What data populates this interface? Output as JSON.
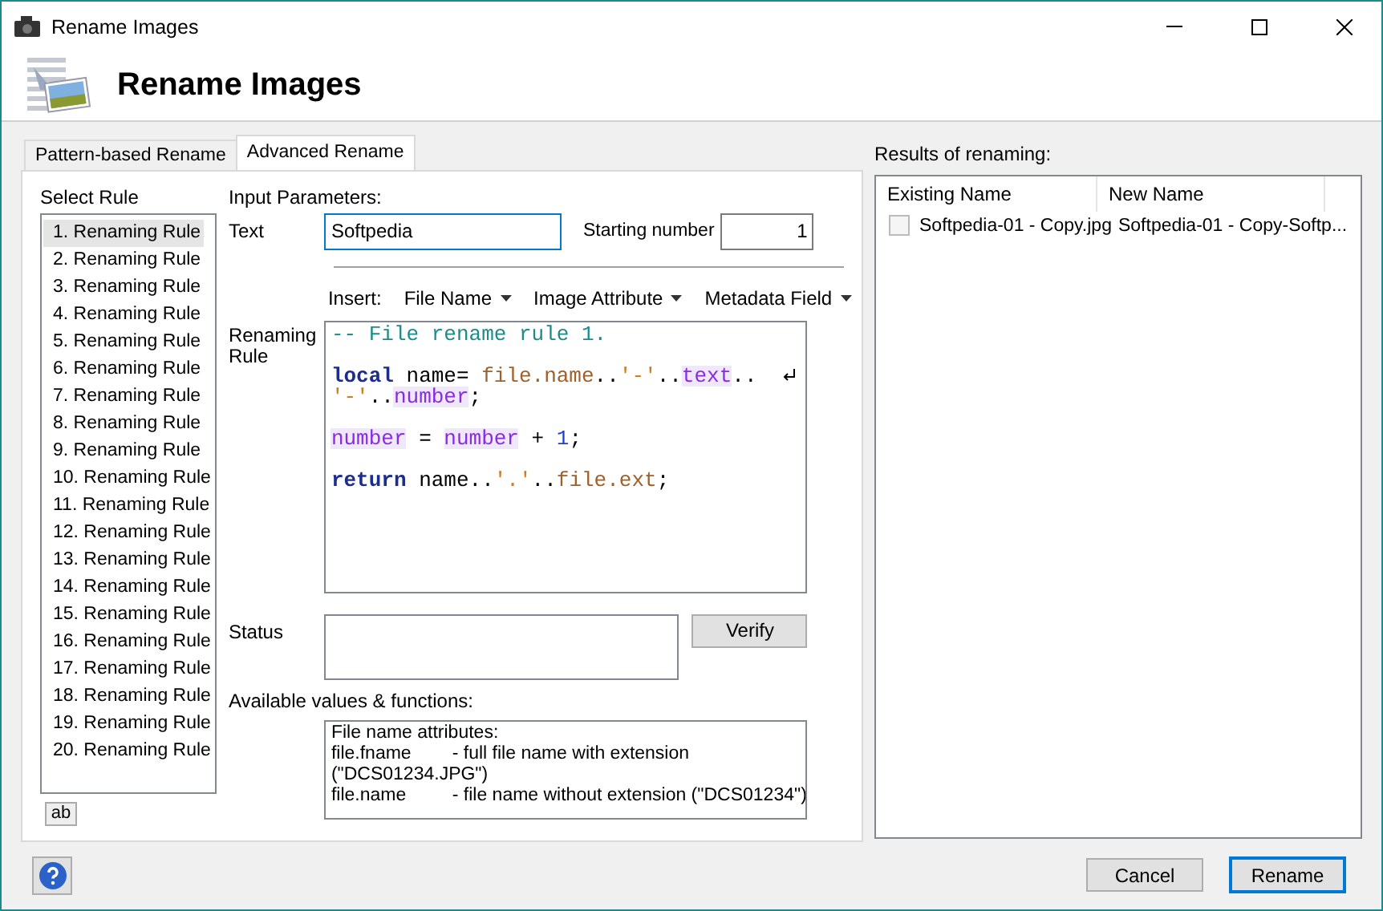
{
  "window": {
    "title": "Rename Images",
    "header": "Rename Images"
  },
  "tabs": [
    {
      "label": "Pattern-based Rename",
      "selected": false
    },
    {
      "label": "Advanced Rename",
      "selected": true
    }
  ],
  "rules": {
    "label": "Select Rule",
    "items": [
      {
        "label": "1. Renaming Rule",
        "selected": true
      },
      {
        "label": "2. Renaming Rule",
        "selected": false
      },
      {
        "label": "3. Renaming Rule",
        "selected": false
      },
      {
        "label": "4. Renaming Rule",
        "selected": false
      },
      {
        "label": "5. Renaming Rule",
        "selected": false
      },
      {
        "label": "6. Renaming Rule",
        "selected": false
      },
      {
        "label": "7. Renaming Rule",
        "selected": false
      },
      {
        "label": "8. Renaming Rule",
        "selected": false
      },
      {
        "label": "9. Renaming Rule",
        "selected": false
      },
      {
        "label": "10. Renaming Rule",
        "selected": false
      },
      {
        "label": "11. Renaming Rule",
        "selected": false
      },
      {
        "label": "12. Renaming Rule",
        "selected": false
      },
      {
        "label": "13. Renaming Rule",
        "selected": false
      },
      {
        "label": "14. Renaming Rule",
        "selected": false
      },
      {
        "label": "15. Renaming Rule",
        "selected": false
      },
      {
        "label": "16. Renaming Rule",
        "selected": false
      },
      {
        "label": "17. Renaming Rule",
        "selected": false
      },
      {
        "label": "18. Renaming Rule",
        "selected": false
      },
      {
        "label": "19. Renaming Rule",
        "selected": false
      },
      {
        "label": "20. Renaming Rule",
        "selected": false
      }
    ],
    "edit_button": "ab"
  },
  "params": {
    "heading": "Input Parameters:",
    "text_label": "Text",
    "text_value": "Softpedia",
    "start_label": "Starting number",
    "start_value": "1",
    "insert_label": "Insert:",
    "insert_menus": [
      "File Name",
      "Image Attribute",
      "Metadata Field"
    ],
    "rule_label": [
      "Renaming",
      "Rule"
    ],
    "code": [
      {
        "gap_before": false,
        "wrapped": false,
        "tokens": [
          {
            "kind": "comment",
            "text": "-- File rename rule 1."
          }
        ]
      },
      {
        "gap_before": true,
        "wrapped": true,
        "tokens": [
          {
            "kind": "keyword",
            "text": "local"
          },
          {
            "kind": "plain",
            "text": " name= "
          },
          {
            "kind": "field",
            "text": "file.name"
          },
          {
            "kind": "plain",
            "text": ".."
          },
          {
            "kind": "string",
            "text": "'-'"
          },
          {
            "kind": "plain",
            "text": ".."
          },
          {
            "kind": "variable",
            "text": "text"
          },
          {
            "kind": "plain",
            "text": ".."
          }
        ]
      },
      {
        "gap_before": false,
        "wrapped": false,
        "tokens": [
          {
            "kind": "string",
            "text": "'-'"
          },
          {
            "kind": "plain",
            "text": ".."
          },
          {
            "kind": "variable",
            "text": "number"
          },
          {
            "kind": "plain",
            "text": ";"
          }
        ]
      },
      {
        "gap_before": true,
        "wrapped": false,
        "tokens": [
          {
            "kind": "variable",
            "text": "number"
          },
          {
            "kind": "plain",
            "text": " = "
          },
          {
            "kind": "variable",
            "text": "number"
          },
          {
            "kind": "plain",
            "text": " + "
          },
          {
            "kind": "number",
            "text": "1"
          },
          {
            "kind": "plain",
            "text": ";"
          }
        ]
      },
      {
        "gap_before": true,
        "wrapped": false,
        "tokens": [
          {
            "kind": "keyword",
            "text": "return"
          },
          {
            "kind": "plain",
            "text": " name.."
          },
          {
            "kind": "string",
            "text": "'.'"
          },
          {
            "kind": "plain",
            "text": ".."
          },
          {
            "kind": "field",
            "text": "file.ext"
          },
          {
            "kind": "plain",
            "text": ";"
          }
        ]
      }
    ],
    "status_label": "Status",
    "verify_button": "Verify",
    "values_label": "Available values & functions:",
    "values_lines": [
      "File name attributes:",
      "file.fname        - full file name with extension",
      "(\"DCS01234.JPG\")",
      "file.name         - file name without extension (\"DCS01234\")"
    ]
  },
  "results": {
    "label": "Results of renaming:",
    "columns": [
      "Existing Name",
      "New Name"
    ],
    "rows": [
      {
        "existing": "Softpedia-01 - Copy.jpg",
        "new": "Softpedia-01 - Copy-Softp...",
        "checked": false
      }
    ]
  },
  "buttons": {
    "cancel": "Cancel",
    "rename": "Rename"
  }
}
